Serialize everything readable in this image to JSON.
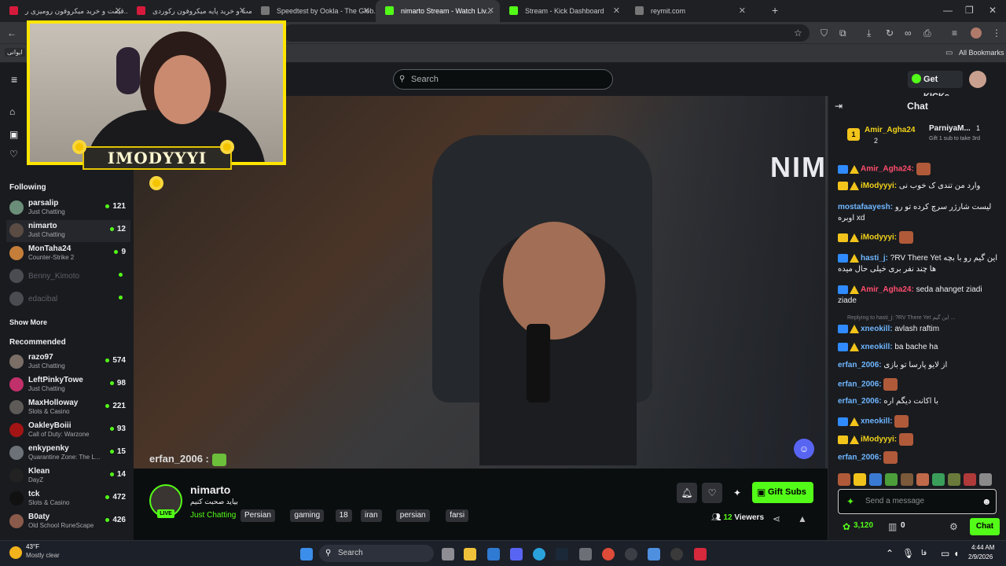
{
  "browser": {
    "tabs": [
      {
        "label": "قیمت و خرید میکروفون رومیزی ر...",
        "fav": "#d61a3c"
      },
      {
        "label": "قیمت و خرید پایه میکروفون رکوردی...",
        "fav": "#d61a3c"
      },
      {
        "label": "Speedtest by Ookla - The Glob...",
        "fav": "#777777"
      },
      {
        "label": "nimarto Stream - Watch Liv...",
        "fav": "#53fc18"
      },
      {
        "label": "Stream - Kick Dashboard",
        "fav": "#53fc18"
      },
      {
        "label": "reymit.com",
        "fav": "#777777"
      }
    ],
    "bookmark_chip": "ایوانی",
    "all_bookmarks": "All Bookmarks"
  },
  "header": {
    "search_placeholder": "Search",
    "get_kicks": "Get KICKs"
  },
  "sidebar": {
    "following_title": "Following",
    "following": [
      {
        "name": "parsalip",
        "category": "Just Chatting",
        "viewers": "121",
        "color": "#6b8e7a"
      },
      {
        "name": "nimarto",
        "category": "Just Chatting",
        "viewers": "12",
        "color": "#5a4b43"
      },
      {
        "name": "MonTaha24",
        "category": "Counter-Strike 2",
        "viewers": "9",
        "color": "#c47e3a"
      },
      {
        "name": "Benny_Kimoto",
        "category": "",
        "viewers": "",
        "color": "#4a4c52"
      },
      {
        "name": "edacibal",
        "category": "",
        "viewers": "",
        "color": "#4a4c52"
      }
    ],
    "show_more": "Show More",
    "recommended_title": "Recommended",
    "recommended": [
      {
        "name": "razo97",
        "category": "Just Chatting",
        "viewers": "574",
        "color": "#7a6e66"
      },
      {
        "name": "LeftPinkyTowe",
        "category": "Just Chatting",
        "viewers": "98",
        "color": "#c0306b"
      },
      {
        "name": "MaxHolloway",
        "category": "Slots & Casino",
        "viewers": "221",
        "color": "#5e5a58"
      },
      {
        "name": "OakleyBoiii",
        "category": "Call of Duty: Warzone",
        "viewers": "93",
        "color": "#a31515"
      },
      {
        "name": "enkypenky",
        "category": "Quarantine Zone: The L...",
        "viewers": "15",
        "color": "#6d7279"
      },
      {
        "name": "Klean",
        "category": "DayZ",
        "viewers": "14",
        "color": "#222222"
      },
      {
        "name": "tck",
        "category": "Slots & Casino",
        "viewers": "472",
        "color": "#111111"
      },
      {
        "name": "B0aty",
        "category": "Old School RuneScape",
        "viewers": "426",
        "color": "#8a5a4a"
      }
    ]
  },
  "webcam": {
    "banner": "IMODYYYI"
  },
  "video": {
    "overlay_user": "erfan_2006 :",
    "wall_text": "NIM"
  },
  "stream": {
    "name": "nimarto",
    "title": "بیاید صحبت کنیم",
    "category": "Just Chatting",
    "live": "LIVE",
    "tags": [
      "Persian",
      "gaming",
      "18",
      "iran",
      "persian",
      "farsi"
    ],
    "gift_subs": "Gift Subs",
    "viewers_count": "12",
    "viewers_label": "Viewers"
  },
  "chat": {
    "title": "Chat",
    "pinned": {
      "user1": "Amir_Agha24",
      "user1_count": "2",
      "user2": "ParniyaM...",
      "user2_count": "1",
      "gift_text": "Gift 1 sub to take 3rd",
      "rank": "1"
    },
    "messages": [
      {
        "user": "Amir_Agha24:",
        "text": "",
        "color": "#ff4d6d",
        "emote": true
      },
      {
        "user": "iModyyyi:",
        "text": "وارد من تندی ک خوب نی",
        "color": "#f2d21b",
        "emote": false
      },
      {
        "user": "mostafaayesh:",
        "text": "لیست شارژر سرچ کرده تو رو اوبره xd",
        "color": "#6fb6ff",
        "emote": false
      },
      {
        "user": "iModyyyi:",
        "text": "",
        "color": "#f2d21b",
        "emote": true
      },
      {
        "user": "hasti_j:",
        "text": "?RV There Yet این گیم رو با بچه ها چند نفر بری خیلی حال میده",
        "color": "#6fb6ff",
        "emote": false
      },
      {
        "user": "Amir_Agha24:",
        "text": "seda ahanget ziadi ziade",
        "color": "#ff4d6d",
        "emote": false
      },
      {
        "user": "xneokill:",
        "text": "avlash raftim",
        "color": "#6fb6ff",
        "emote": false
      },
      {
        "user": "xneokill:",
        "text": "ba bache ha",
        "color": "#6fb6ff",
        "emote": false
      },
      {
        "user": "erfan_2006:",
        "text": "از لایو پارسا تو بازی",
        "color": "#6fb6ff",
        "emote": false
      },
      {
        "user": "erfan_2006:",
        "text": "",
        "color": "#6fb6ff",
        "emote": true
      },
      {
        "user": "erfan_2006:",
        "text": "با اکانت دیگم اره",
        "color": "#6fb6ff",
        "emote": false
      },
      {
        "user": "xneokill:",
        "text": "",
        "color": "#6fb6ff",
        "emote": true
      },
      {
        "user": "iModyyyi:",
        "text": "",
        "color": "#f2d21b",
        "emote": true
      },
      {
        "user": "erfan_2006:",
        "text": "",
        "color": "#6fb6ff",
        "emote": true
      }
    ],
    "reply_hint": "Replying to hasti_j: ?RV There Yet این گیم ...",
    "input_placeholder": "Send a message",
    "points": "3,120",
    "subs": "0",
    "chat_button": "Chat"
  },
  "taskbar": {
    "temp": "43°F",
    "weather": "Mostly clear",
    "search": "Search",
    "time": "4:44 AM",
    "date": "2/9/2026",
    "lang": "فا"
  }
}
